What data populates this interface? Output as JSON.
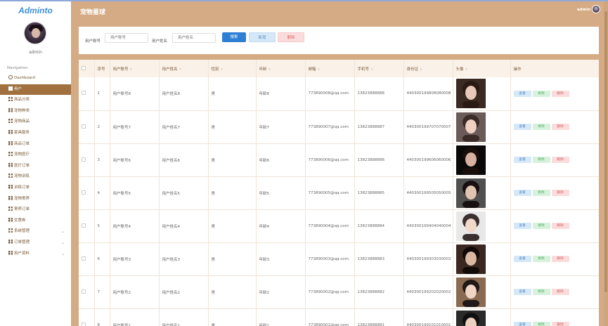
{
  "app": {
    "brand": "Adminto",
    "page_title": "宠物星球"
  },
  "user": {
    "name": "admin",
    "header_name": "admin"
  },
  "nav": {
    "title": "Navigation",
    "items": [
      {
        "label": "Dashboard",
        "icon": "home-icon"
      },
      {
        "label": "用户",
        "icon": "user-icon"
      },
      {
        "label": "商品分类",
        "icon": "grid-icon"
      },
      {
        "label": "宠物种类",
        "icon": "grid-icon"
      },
      {
        "label": "宠物商品",
        "icon": "grid-icon"
      },
      {
        "label": "家具服务",
        "icon": "grid-icon"
      },
      {
        "label": "商品订单",
        "icon": "grid-icon"
      },
      {
        "label": "宠物医疗",
        "icon": "grid-icon"
      },
      {
        "label": "医疗订单",
        "icon": "grid-icon"
      },
      {
        "label": "宠物训练",
        "icon": "grid-icon"
      },
      {
        "label": "训练订单",
        "icon": "grid-icon"
      },
      {
        "label": "宠物寄养",
        "icon": "grid-icon"
      },
      {
        "label": "寄养订单",
        "icon": "grid-icon"
      },
      {
        "label": "优惠券",
        "icon": "grid-icon"
      },
      {
        "label": "系统管理",
        "icon": "grid-icon"
      },
      {
        "label": "订单管理",
        "icon": "grid-icon"
      },
      {
        "label": "用户资料",
        "icon": "grid-icon"
      }
    ]
  },
  "search": {
    "label_account": "用户账号",
    "placeholder_account": "用户账号",
    "label_name": "用户姓名",
    "placeholder_name": "用户姓名",
    "btn_search": "搜索",
    "btn_add": "新增",
    "btn_delete": "删除"
  },
  "table": {
    "headers": [
      "序号",
      "用户账号",
      "用户姓名",
      "性别",
      "年龄",
      "邮箱",
      "手机号",
      "身份证",
      "头像",
      "操作"
    ],
    "actions": {
      "view": "查看",
      "edit": "修改",
      "delete": "删除"
    },
    "rows": [
      {
        "no": "1",
        "account": "用户账号8",
        "name": "用户姓名8",
        "gender": "男",
        "age": "年龄8",
        "email": "773890008@qq.com",
        "phone": "13823888888",
        "idcard": "440300199808080008"
      },
      {
        "no": "2",
        "account": "用户账号7",
        "name": "用户姓名7",
        "gender": "男",
        "age": "年龄7",
        "email": "773890007@qq.com",
        "phone": "13823888887",
        "idcard": "440300199707070007"
      },
      {
        "no": "3",
        "account": "用户账号6",
        "name": "用户姓名6",
        "gender": "男",
        "age": "年龄6",
        "email": "773890006@qq.com",
        "phone": "13823888886",
        "idcard": "440300199606060006"
      },
      {
        "no": "4",
        "account": "用户账号5",
        "name": "用户姓名5",
        "gender": "男",
        "age": "年龄5",
        "email": "773890005@qq.com",
        "phone": "13823888885",
        "idcard": "440300199505050005"
      },
      {
        "no": "5",
        "account": "用户账号4",
        "name": "用户姓名4",
        "gender": "男",
        "age": "年龄4",
        "email": "773890004@qq.com",
        "phone": "13823888884",
        "idcard": "440300199404040004"
      },
      {
        "no": "6",
        "account": "用户账号3",
        "name": "用户姓名3",
        "gender": "男",
        "age": "年龄3",
        "email": "773890003@qq.com",
        "phone": "13823888883",
        "idcard": "440300199303030003"
      },
      {
        "no": "7",
        "account": "用户账号2",
        "name": "用户姓名2",
        "gender": "男",
        "age": "年龄2",
        "email": "773890002@qq.com",
        "phone": "13823888882",
        "idcard": "440300199202020002"
      },
      {
        "no": "8",
        "account": "用户账号1",
        "name": "用户姓名1",
        "gender": "男",
        "age": "年龄1",
        "email": "773890001@qq.com",
        "phone": "13823888881",
        "idcard": "440300199101010001"
      }
    ]
  },
  "colors": {
    "accent": "#a0703f",
    "header_bg": "#d4ab84",
    "primary": "#2d7fd3",
    "brand": "#3b8fd8"
  }
}
